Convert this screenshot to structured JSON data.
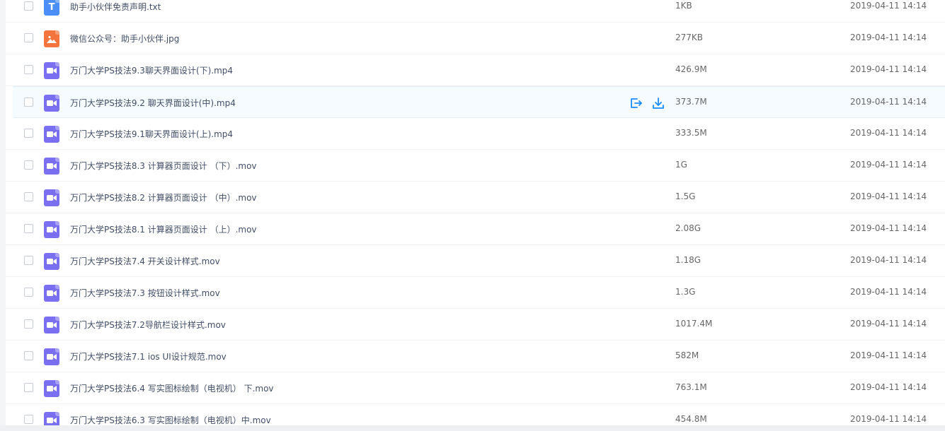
{
  "files": [
    {
      "name": "助手小伙伴免责声明.txt",
      "type": "txt",
      "type_icon": "T",
      "size": "1KB",
      "date": "2019-04-11 14:14"
    },
    {
      "name": "微信公众号：助手小伙伴.jpg",
      "type": "img",
      "type_icon": "",
      "size": "277KB",
      "date": "2019-04-11 14:14"
    },
    {
      "name": "万门大学PS技法9.3聊天界面设计(下).mp4",
      "type": "video",
      "type_icon": "",
      "size": "426.9M",
      "date": "2019-04-11 14:14"
    },
    {
      "name": "万门大学PS技法9.2 聊天界面设计(中).mp4",
      "type": "video",
      "type_icon": "",
      "size": "373.7M",
      "date": "2019-04-11 14:14",
      "hovered": true
    },
    {
      "name": "万门大学PS技法9.1聊天界面设计(上).mp4",
      "type": "video",
      "type_icon": "",
      "size": "333.5M",
      "date": "2019-04-11 14:14"
    },
    {
      "name": "万门大学PS技法8.3 计算器页面设计 （下）.mov",
      "type": "video",
      "type_icon": "",
      "size": "1G",
      "date": "2019-04-11 14:14"
    },
    {
      "name": "万门大学PS技法8.2 计算器页面设计 （中）.mov",
      "type": "video",
      "type_icon": "",
      "size": "1.5G",
      "date": "2019-04-11 14:14"
    },
    {
      "name": "万门大学PS技法8.1 计算器页面设计 （上）.mov",
      "type": "video",
      "type_icon": "",
      "size": "2.08G",
      "date": "2019-04-11 14:14"
    },
    {
      "name": "万门大学PS技法7.4 开关设计样式.mov",
      "type": "video",
      "type_icon": "",
      "size": "1.18G",
      "date": "2019-04-11 14:14"
    },
    {
      "name": "万门大学PS技法7.3 按钮设计样式.mov",
      "type": "video",
      "type_icon": "",
      "size": "1.3G",
      "date": "2019-04-11 14:14"
    },
    {
      "name": "万门大学PS技法7.2导航栏设计样式.mov",
      "type": "video",
      "type_icon": "",
      "size": "1017.4M",
      "date": "2019-04-11 14:14"
    },
    {
      "name": "万门大学PS技法7.1 ios UI设计规范.mov",
      "type": "video",
      "type_icon": "",
      "size": "582M",
      "date": "2019-04-11 14:14"
    },
    {
      "name": "万门大学PS技法6.4 写实图标绘制（电视机） 下.mov",
      "type": "video",
      "type_icon": "",
      "size": "763.1M",
      "date": "2019-04-11 14:14"
    },
    {
      "name": "万门大学PS技法6.3 写实图标绘制（电视机）中.mov",
      "type": "video",
      "type_icon": "",
      "size": "454.8M",
      "date": "2019-04-11 14:14"
    }
  ],
  "hover_actions": [
    {
      "icon": "share-icon",
      "color": "#1a8cff"
    },
    {
      "icon": "download-icon",
      "color": "#1a8cff"
    }
  ],
  "colors": {
    "accent": "#1a8cff",
    "txt_icon": "#4c8ef7",
    "img_icon": "#f4743d",
    "video_icon": "#7a6ff0"
  }
}
